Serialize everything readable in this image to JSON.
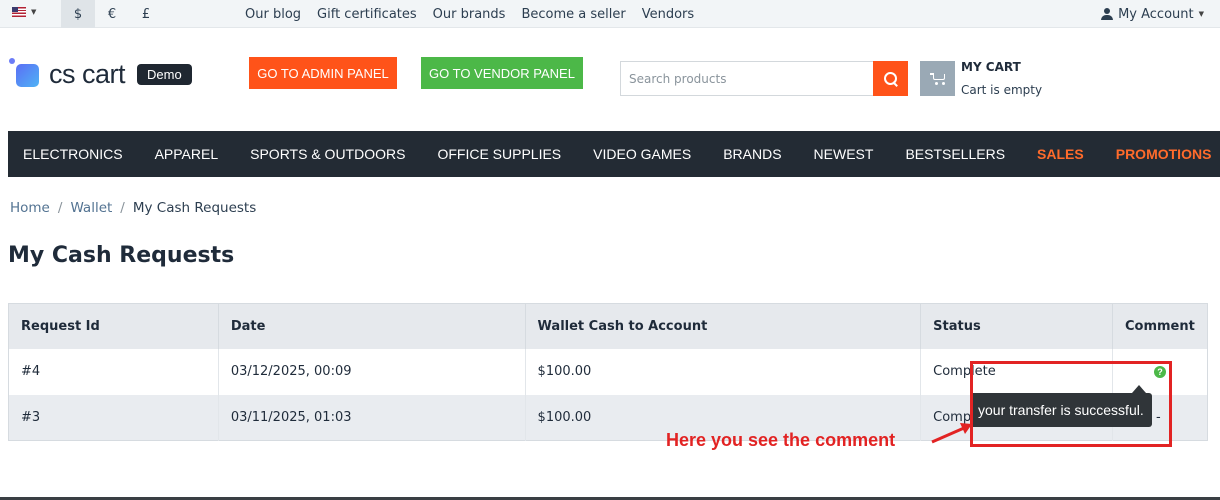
{
  "topbar": {
    "currencies": [
      "$",
      "€",
      "£"
    ],
    "links": [
      "Our blog",
      "Gift certificates",
      "Our brands",
      "Become a seller",
      "Vendors"
    ],
    "account_label": "My Account"
  },
  "header": {
    "logo_text": "cs cart",
    "demo_badge": "Demo",
    "admin_button": "GO TO ADMIN PANEL",
    "vendor_button": "GO TO VENDOR PANEL",
    "search_placeholder": "Search products",
    "cart_title": "MY CART",
    "cart_status": "Cart is empty"
  },
  "nav": {
    "items": [
      "ELECTRONICS",
      "APPAREL",
      "SPORTS & OUTDOORS",
      "OFFICE SUPPLIES",
      "VIDEO GAMES",
      "BRANDS",
      "NEWEST",
      "BESTSELLERS",
      "SALES",
      "PROMOTIONS"
    ]
  },
  "breadcrumb": {
    "home": "Home",
    "wallet": "Wallet",
    "current": "My Cash Requests",
    "separator": "/"
  },
  "page": {
    "title": "My Cash Requests"
  },
  "table": {
    "headers": [
      "Request Id",
      "Date",
      "Wallet Cash to Account",
      "Status",
      "Comment"
    ],
    "rows": [
      {
        "id": "#4",
        "date": "03/12/2025, 00:09",
        "amount": "$100.00",
        "status": "Complete",
        "comment_icon": "?"
      },
      {
        "id": "#3",
        "date": "03/11/2025, 01:03",
        "amount": "$100.00",
        "status": "Complete",
        "comment": "-"
      }
    ]
  },
  "tooltip": {
    "text": "your transfer is successful."
  },
  "annotation": {
    "text": "Here you see the comment",
    "color": "#e22323"
  },
  "colors": {
    "accent_orange": "#ff5319",
    "accent_green": "#4cb848",
    "nav_bg": "#232b34"
  }
}
